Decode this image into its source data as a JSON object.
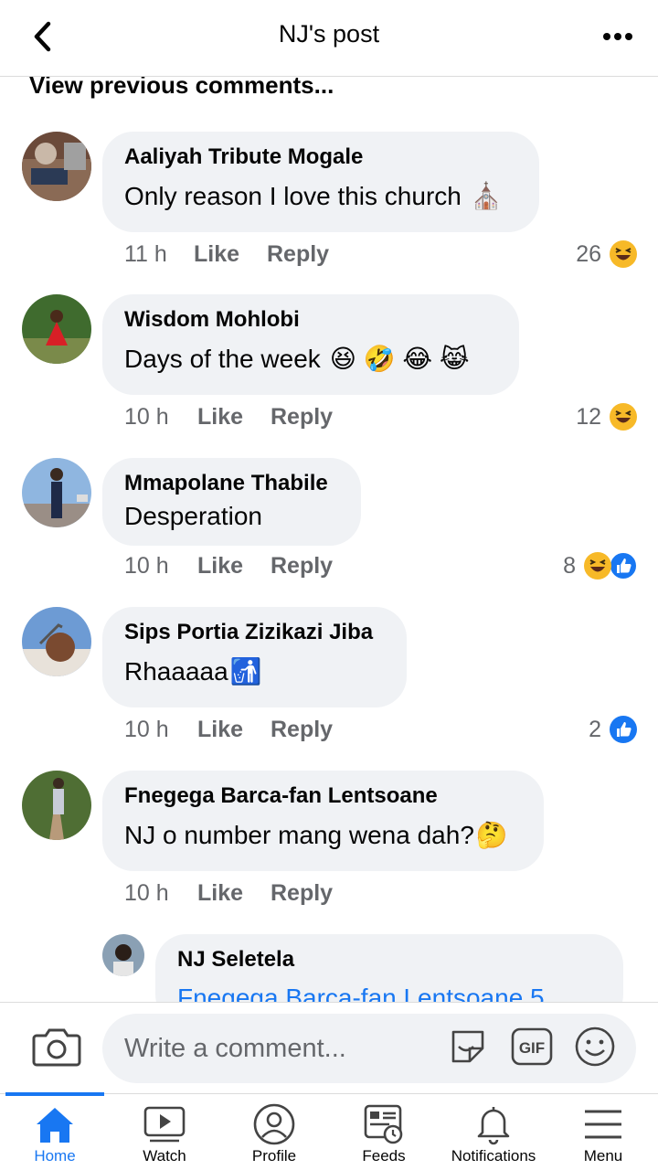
{
  "header": {
    "title": "NJ's post"
  },
  "feed": {
    "view_previous": "View previous comments...",
    "comments": [
      {
        "name": "Aaliyah Tribute Mogale",
        "text": "Only reason I love this church",
        "emoji": "⛪",
        "time": "11 h",
        "like": "Like",
        "reply": "Reply",
        "reaction_count": "26"
      },
      {
        "name": "Wisdom Mohlobi",
        "text": "Days of the week",
        "emoji": "😆 🤣 😂 😹",
        "time": "10 h",
        "like": "Like",
        "reply": "Reply",
        "reaction_count": "12"
      },
      {
        "name": "Mmapolane Thabile",
        "text": "Desperation",
        "emoji": "",
        "time": "10 h",
        "like": "Like",
        "reply": "Reply",
        "reaction_count": "8"
      },
      {
        "name": "Sips Portia Zizikazi Jiba",
        "text": "Rhaaaaa",
        "emoji": "🚮",
        "time": "10 h",
        "like": "Like",
        "reply": "Reply",
        "reaction_count": "2"
      },
      {
        "name": "Fnegega Barca-fan Lentsoane",
        "text": "NJ o number mang wena dah?",
        "emoji": "🤔",
        "time": "10 h",
        "like": "Like",
        "reply": "Reply",
        "reaction_count": ""
      }
    ],
    "reply": {
      "name": "NJ Seletela",
      "text": "Fnegega Barca-fan Lentsoane 5"
    }
  },
  "composer": {
    "placeholder": "Write a comment..."
  },
  "nav": {
    "items": [
      {
        "label": "Home",
        "icon": "home-icon",
        "active": true
      },
      {
        "label": "Watch",
        "icon": "watch-icon",
        "active": false
      },
      {
        "label": "Profile",
        "icon": "profile-icon",
        "active": false
      },
      {
        "label": "Feeds",
        "icon": "feeds-icon",
        "active": false
      },
      {
        "label": "Notifications",
        "icon": "bell-icon",
        "active": false
      },
      {
        "label": "Menu",
        "icon": "menu-icon",
        "active": false
      }
    ]
  },
  "colors": {
    "accent": "#1877f2",
    "bubble": "#f0f2f5",
    "meta": "#65676b",
    "haha": "#f7b928"
  }
}
